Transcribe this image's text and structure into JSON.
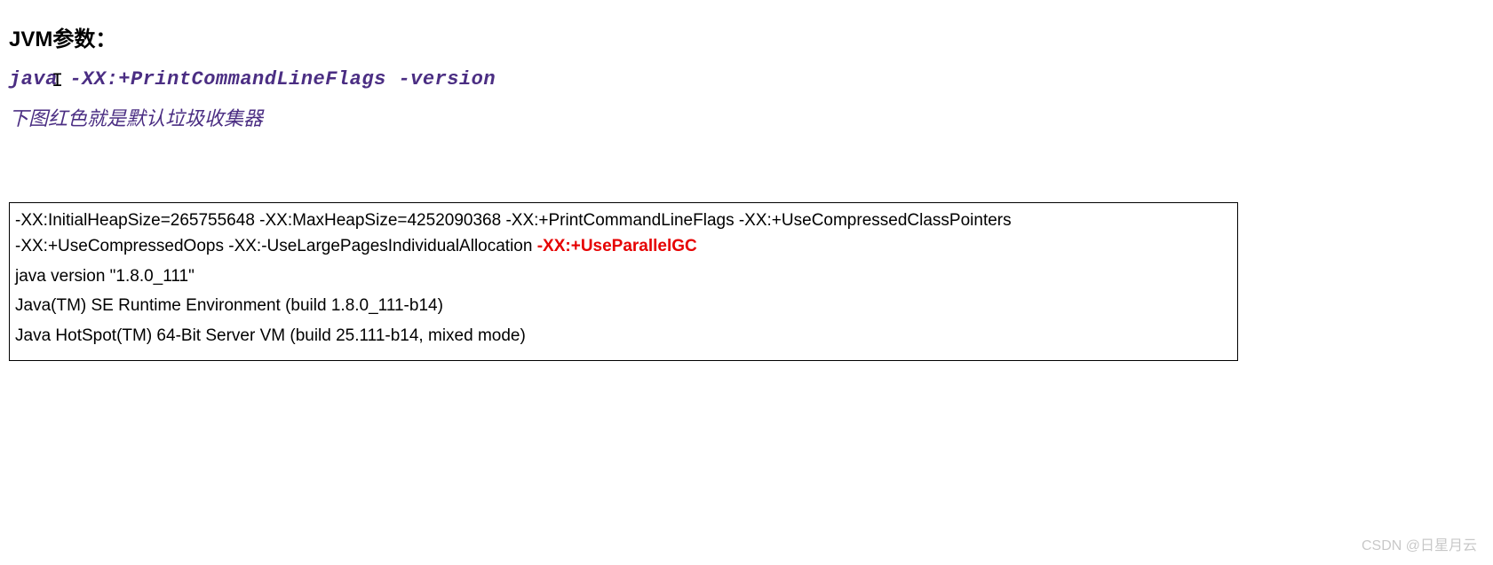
{
  "heading": "JVM参数：",
  "command": "java -XX:+PrintCommandLineFlags -version",
  "note": "下图红色就是默认垃圾收集器",
  "output": {
    "flags_line1": "-XX:InitialHeapSize=265755648 -XX:MaxHeapSize=4252090368 -XX:+PrintCommandLineFlags -XX:+UseCompressedClassPointers",
    "flags_line2_prefix": "-XX:+UseCompressedOops -XX:-UseLargePagesIndividualAllocation ",
    "flags_line2_red": "-XX:+UseParallelGC",
    "version": "java version \"1.8.0_111\"",
    "runtime": "Java(TM) SE Runtime Environment (build 1.8.0_111-b14)",
    "vm": "Java HotSpot(TM) 64-Bit Server VM (build 25.111-b14, mixed mode)"
  },
  "watermark": "CSDN @日星月云"
}
